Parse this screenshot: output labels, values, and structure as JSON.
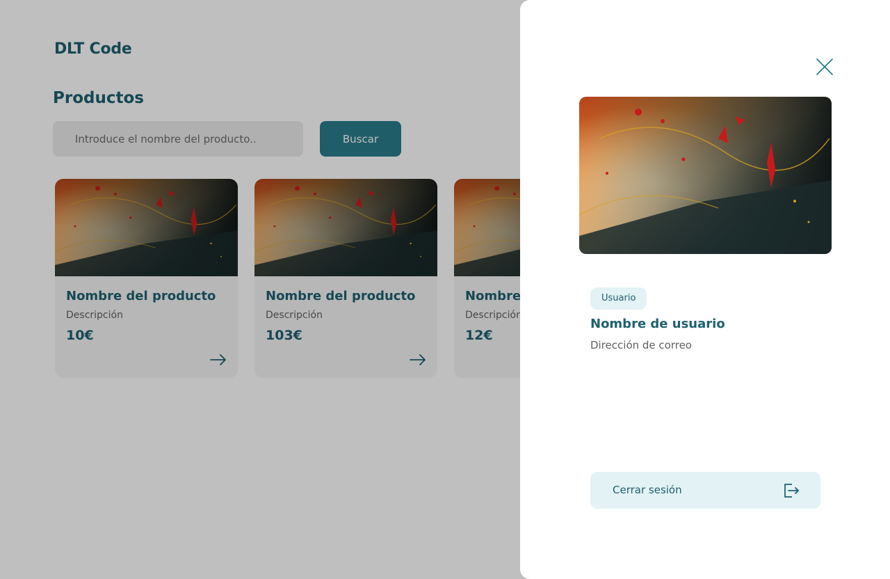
{
  "app": {
    "brand": "DLT Code"
  },
  "products": {
    "title": "Productos",
    "search": {
      "placeholder": "Introduce el nombre del producto..",
      "button_label": "Buscar"
    },
    "items": [
      {
        "name": "Nombre del producto",
        "description": "Descripción",
        "price": "10€"
      },
      {
        "name": "Nombre del producto",
        "description": "Descripción",
        "price": "103€"
      },
      {
        "name": "Nombre del producto",
        "description": "Descripción",
        "price": "12€"
      }
    ]
  },
  "drawer": {
    "role_badge": "Usuario",
    "user_name": "Nombre de usuario",
    "user_email": "Dirección de correo",
    "logout_label": "Cerrar sesión",
    "icons": {
      "close": "close-icon",
      "logout": "logout-icon",
      "arrow": "arrow-right-icon"
    }
  },
  "colors": {
    "primary": "#1e6170",
    "button": "#2a7d8c",
    "badge_bg": "#e3f2f4",
    "overlay": "rgba(0,0,0,0.25)"
  }
}
